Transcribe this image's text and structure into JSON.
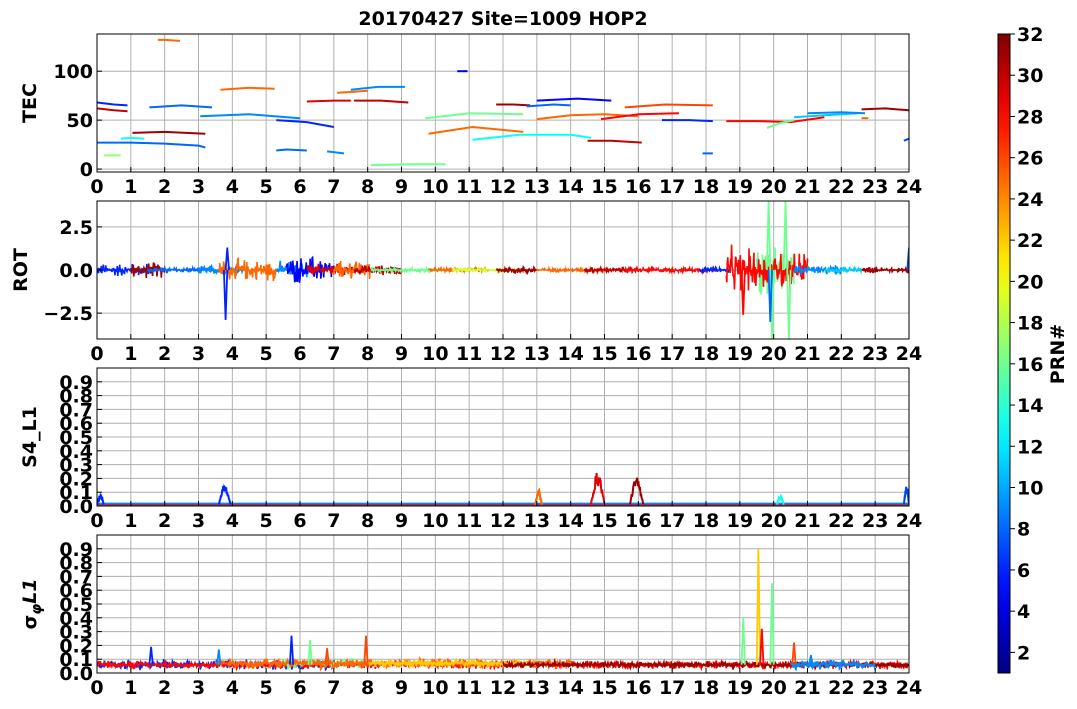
{
  "title": "20170427 Site=1009 HOP2",
  "colorbar": {
    "label": "PRN#",
    "min": 1,
    "max": 32,
    "ticks": [
      "2",
      "4",
      "6",
      "8",
      "10",
      "12",
      "14",
      "16",
      "18",
      "20",
      "22",
      "24",
      "26",
      "28",
      "30",
      "32"
    ]
  },
  "chart_data": [
    {
      "type": "line",
      "ylabel": "TEC",
      "xlim": [
        0,
        24
      ],
      "ylim": [
        -3,
        138
      ],
      "xticks": [
        "0",
        "1",
        "2",
        "3",
        "4",
        "5",
        "6",
        "7",
        "8",
        "9",
        "10",
        "11",
        "12",
        "13",
        "14",
        "15",
        "16",
        "17",
        "18",
        "19",
        "20",
        "21",
        "22",
        "23",
        "24"
      ],
      "yticks": [
        {
          "v": 0,
          "label": "0"
        },
        {
          "v": 50,
          "label": "50"
        },
        {
          "v": 100,
          "label": "100"
        }
      ],
      "grid": true,
      "series": [
        {
          "prn": 6,
          "x": [
            0,
            0.5,
            0.9
          ],
          "y": [
            68,
            66,
            65
          ]
        },
        {
          "prn": 30,
          "x": [
            0,
            0.5,
            0.9
          ],
          "y": [
            62,
            60,
            59
          ]
        },
        {
          "prn": 8,
          "x": [
            0,
            1,
            2,
            3,
            3.2
          ],
          "y": [
            27,
            27,
            26,
            24,
            22
          ]
        },
        {
          "prn": 13,
          "x": [
            0.7,
            1.0,
            1.4
          ],
          "y": [
            31,
            32,
            31
          ]
        },
        {
          "prn": 17,
          "x": [
            0.2,
            0.45,
            0.7
          ],
          "y": [
            14,
            14,
            14
          ]
        },
        {
          "prn": 31,
          "x": [
            1.05,
            2,
            3.2
          ],
          "y": [
            37,
            38,
            36
          ]
        },
        {
          "prn": 8,
          "x": [
            1.55,
            2.5,
            3.4
          ],
          "y": [
            63,
            65,
            63
          ]
        },
        {
          "prn": 25,
          "x": [
            1.8,
            2,
            2.45
          ],
          "y": [
            132,
            132,
            131
          ]
        },
        {
          "prn": 9,
          "x": [
            3.05,
            4.5,
            6.0
          ],
          "y": [
            54,
            56,
            52
          ]
        },
        {
          "prn": 25,
          "x": [
            3.65,
            4.5,
            5.25
          ],
          "y": [
            81,
            83,
            82
          ]
        },
        {
          "prn": 6,
          "x": [
            5.3,
            6.2,
            7.0
          ],
          "y": [
            50,
            48,
            43
          ]
        },
        {
          "prn": 8,
          "x": [
            5.3,
            5.6,
            6.2
          ],
          "y": [
            19,
            20,
            19
          ]
        },
        {
          "prn": 9,
          "x": [
            6.8,
            7.3
          ],
          "y": [
            18,
            16
          ]
        },
        {
          "prn": 29,
          "x": [
            6.2,
            7,
            7.5
          ],
          "y": [
            69,
            70,
            70
          ]
        },
        {
          "prn": 25,
          "x": [
            7.1,
            7.6,
            8.0
          ],
          "y": [
            78,
            79,
            80
          ]
        },
        {
          "prn": 9,
          "x": [
            7.5,
            8.3,
            9.1
          ],
          "y": [
            81,
            84,
            84
          ]
        },
        {
          "prn": 30,
          "x": [
            7.6,
            8.4,
            9.2
          ],
          "y": [
            70,
            70,
            68
          ]
        },
        {
          "prn": 16,
          "x": [
            8.1,
            9.2,
            10.3
          ],
          "y": [
            4,
            5,
            5
          ]
        },
        {
          "prn": 4,
          "x": [
            10.65,
            10.95
          ],
          "y": [
            100,
            100
          ]
        },
        {
          "prn": 16,
          "x": [
            9.7,
            11,
            12.6
          ],
          "y": [
            52,
            57,
            56
          ]
        },
        {
          "prn": 25,
          "x": [
            9.8,
            11.1,
            12.6
          ],
          "y": [
            36,
            43,
            38
          ]
        },
        {
          "prn": 13,
          "x": [
            11.1,
            12.5,
            14.0,
            14.6
          ],
          "y": [
            30,
            35,
            35,
            32
          ]
        },
        {
          "prn": 31,
          "x": [
            11.8,
            12.3,
            12.8
          ],
          "y": [
            66,
            66,
            65
          ]
        },
        {
          "prn": 8,
          "x": [
            12.7,
            13.5,
            14.0
          ],
          "y": [
            64,
            66,
            65
          ]
        },
        {
          "prn": 5,
          "x": [
            13.0,
            14.2,
            15.2
          ],
          "y": [
            70,
            72,
            70
          ]
        },
        {
          "prn": 25,
          "x": [
            13.0,
            14.0,
            15.0,
            16.0
          ],
          "y": [
            51,
            55,
            56,
            54
          ]
        },
        {
          "prn": 30,
          "x": [
            14.5,
            15.2,
            16.1
          ],
          "y": [
            29,
            29,
            27
          ]
        },
        {
          "prn": 28,
          "x": [
            14.9,
            16.0,
            17.2
          ],
          "y": [
            51,
            56,
            57
          ]
        },
        {
          "prn": 26,
          "x": [
            15.6,
            16.8,
            18.2
          ],
          "y": [
            63,
            66,
            65
          ]
        },
        {
          "prn": 6,
          "x": [
            16.7,
            17.5,
            18.2
          ],
          "y": [
            50,
            50,
            49
          ]
        },
        {
          "prn": 8,
          "x": [
            17.9,
            18.2
          ],
          "y": [
            16,
            16
          ]
        },
        {
          "prn": 28,
          "x": [
            18.6,
            19.5,
            20.5,
            21.5
          ],
          "y": [
            49,
            49,
            48,
            53
          ]
        },
        {
          "prn": 16,
          "x": [
            19.8,
            20.2,
            20.6
          ],
          "y": [
            42,
            47,
            50
          ]
        },
        {
          "prn": 11,
          "x": [
            20.6,
            21.5,
            22.5
          ],
          "y": [
            53,
            55,
            57
          ]
        },
        {
          "prn": 9,
          "x": [
            21.0,
            22.0,
            22.7
          ],
          "y": [
            57,
            58,
            57
          ]
        },
        {
          "prn": 25,
          "x": [
            22.6,
            22.8
          ],
          "y": [
            52,
            52
          ]
        },
        {
          "prn": 31,
          "x": [
            22.6,
            23.3,
            24
          ],
          "y": [
            61,
            62,
            60
          ]
        },
        {
          "prn": 7,
          "x": [
            23.85,
            24
          ],
          "y": [
            29,
            31
          ]
        }
      ]
    },
    {
      "type": "line",
      "ylabel": "ROT",
      "xlim": [
        0,
        24
      ],
      "ylim": [
        -4,
        4
      ],
      "xticks": [
        "0",
        "1",
        "2",
        "3",
        "4",
        "5",
        "6",
        "7",
        "8",
        "9",
        "10",
        "11",
        "12",
        "13",
        "14",
        "15",
        "16",
        "17",
        "18",
        "19",
        "20",
        "21",
        "22",
        "23",
        "24"
      ],
      "yticks": [
        {
          "v": -2.5,
          "label": "−2.5"
        },
        {
          "v": 0,
          "label": "0.0"
        },
        {
          "v": 2.5,
          "label": "2.5"
        }
      ],
      "grid": true,
      "noise_segments": [
        {
          "prn": 6,
          "x0": 0.0,
          "x1": 1.6,
          "amp": 0.35
        },
        {
          "prn": 31,
          "x0": 1.0,
          "x1": 2.0,
          "amp": 0.4
        },
        {
          "prn": 8,
          "x0": 1.5,
          "x1": 3.4,
          "amp": 0.15
        },
        {
          "prn": 9,
          "x0": 3.0,
          "x1": 4.3,
          "amp": 0.25
        },
        {
          "prn": 25,
          "x0": 3.6,
          "x1": 5.3,
          "amp": 0.55
        },
        {
          "prn": 9,
          "x0": 5.3,
          "x1": 6.3,
          "amp": 0.45
        },
        {
          "prn": 5,
          "x0": 5.6,
          "x1": 7.0,
          "amp": 0.7
        },
        {
          "prn": 29,
          "x0": 6.2,
          "x1": 7.6,
          "amp": 0.3
        },
        {
          "prn": 25,
          "x0": 7.0,
          "x1": 8.1,
          "amp": 0.45
        },
        {
          "prn": 30,
          "x0": 7.6,
          "x1": 9.0,
          "amp": 0.25
        },
        {
          "prn": 16,
          "x0": 8.1,
          "x1": 10.2,
          "amp": 0.1
        },
        {
          "prn": 25,
          "x0": 9.8,
          "x1": 11.6,
          "amp": 0.1
        },
        {
          "prn": 19,
          "x0": 10.5,
          "x1": 12.5,
          "amp": 0.08
        },
        {
          "prn": 31,
          "x0": 11.8,
          "x1": 13.0,
          "amp": 0.2
        },
        {
          "prn": 25,
          "x0": 13.0,
          "x1": 15.2,
          "amp": 0.1
        },
        {
          "prn": 30,
          "x0": 14.4,
          "x1": 16.0,
          "amp": 0.15
        },
        {
          "prn": 28,
          "x0": 15.6,
          "x1": 18.3,
          "amp": 0.12
        },
        {
          "prn": 6,
          "x0": 17.8,
          "x1": 18.7,
          "amp": 0.15
        },
        {
          "prn": 16,
          "x0": 19.5,
          "x1": 20.6,
          "amp": 1.4
        },
        {
          "prn": 28,
          "x0": 18.6,
          "x1": 21.0,
          "amp": 1.1
        },
        {
          "prn": 9,
          "x0": 20.6,
          "x1": 22.0,
          "amp": 0.25
        },
        {
          "prn": 11,
          "x0": 21.5,
          "x1": 22.6,
          "amp": 0.15
        },
        {
          "prn": 31,
          "x0": 22.6,
          "x1": 24.0,
          "amp": 0.15
        }
      ],
      "spikes": [
        {
          "prn": 6,
          "x": 3.8,
          "y": -2.9
        },
        {
          "prn": 6,
          "x": 3.85,
          "y": 1.3
        },
        {
          "prn": 28,
          "x": 19.1,
          "y": -2.6
        },
        {
          "prn": 16,
          "x": 19.85,
          "y": 4.0
        },
        {
          "prn": 16,
          "x": 19.95,
          "y": -4.0
        },
        {
          "prn": 16,
          "x": 20.35,
          "y": 4.0
        },
        {
          "prn": 16,
          "x": 20.45,
          "y": -4.0
        },
        {
          "prn": 8,
          "x": 19.9,
          "y": -3.0
        },
        {
          "prn": 7,
          "x": 24.0,
          "y": 1.3
        }
      ]
    },
    {
      "type": "line",
      "ylabel": "S4_L1",
      "xlim": [
        0,
        24
      ],
      "ylim": [
        0,
        1.0
      ],
      "xticks": [
        "0",
        "1",
        "2",
        "3",
        "4",
        "5",
        "6",
        "7",
        "8",
        "9",
        "10",
        "11",
        "12",
        "13",
        "14",
        "15",
        "16",
        "17",
        "18",
        "19",
        "20",
        "21",
        "22",
        "23",
        "24"
      ],
      "yticks": [
        {
          "v": 0,
          "label": "0.0"
        },
        {
          "v": 0.1,
          "label": "0.1"
        },
        {
          "v": 0.2,
          "label": "0.2"
        },
        {
          "v": 0.3,
          "label": "0.3"
        },
        {
          "v": 0.4,
          "label": "0.4"
        },
        {
          "v": 0.5,
          "label": "0.5"
        },
        {
          "v": 0.6,
          "label": "0.6"
        },
        {
          "v": 0.7,
          "label": "0.7"
        },
        {
          "v": 0.8,
          "label": "0.8"
        },
        {
          "v": 0.9,
          "label": "0.9"
        }
      ],
      "grid": true,
      "baseline": 0.01,
      "bursts": [
        {
          "prn": 6,
          "x0": 0.0,
          "x1": 0.2,
          "peak": 0.08
        },
        {
          "prn": 6,
          "x0": 3.6,
          "x1": 3.95,
          "peak": 0.15
        },
        {
          "prn": 25,
          "x0": 12.95,
          "x1": 13.15,
          "peak": 0.11
        },
        {
          "prn": 29,
          "x0": 14.6,
          "x1": 15.0,
          "peak": 0.24
        },
        {
          "prn": 31,
          "x0": 15.75,
          "x1": 16.15,
          "peak": 0.2
        },
        {
          "prn": 13,
          "x0": 20.1,
          "x1": 20.3,
          "peak": 0.07
        },
        {
          "prn": 7,
          "x0": 23.85,
          "x1": 24.0,
          "peak": 0.14
        }
      ]
    },
    {
      "type": "line",
      "ylabel": "σφL1",
      "xlim": [
        0,
        24
      ],
      "ylim": [
        0,
        1.0
      ],
      "xticks": [
        "0",
        "1",
        "2",
        "3",
        "4",
        "5",
        "6",
        "7",
        "8",
        "9",
        "10",
        "11",
        "12",
        "13",
        "14",
        "15",
        "16",
        "17",
        "18",
        "19",
        "20",
        "21",
        "22",
        "23",
        "24"
      ],
      "yticks": [
        {
          "v": 0,
          "label": "0.0"
        },
        {
          "v": 0.1,
          "label": "0.1"
        },
        {
          "v": 0.2,
          "label": "0.2"
        },
        {
          "v": 0.3,
          "label": "0.3"
        },
        {
          "v": 0.4,
          "label": "0.4"
        },
        {
          "v": 0.5,
          "label": "0.5"
        },
        {
          "v": 0.6,
          "label": "0.6"
        },
        {
          "v": 0.7,
          "label": "0.7"
        },
        {
          "v": 0.8,
          "label": "0.8"
        },
        {
          "v": 0.9,
          "label": "0.9"
        }
      ],
      "grid": true,
      "noise_segments": [
        {
          "prn": 6,
          "x0": 0.0,
          "x1": 7.0,
          "base": 0.06,
          "amp": 0.03
        },
        {
          "prn": 28,
          "x0": 0.0,
          "x1": 24.0,
          "base": 0.06,
          "amp": 0.025
        },
        {
          "prn": 16,
          "x0": 5.5,
          "x1": 8.0,
          "base": 0.07,
          "amp": 0.04
        },
        {
          "prn": 25,
          "x0": 3.5,
          "x1": 14.0,
          "base": 0.07,
          "amp": 0.03
        },
        {
          "prn": 22,
          "x0": 8.0,
          "x1": 13.0,
          "base": 0.07,
          "amp": 0.025
        },
        {
          "prn": 31,
          "x0": 12.0,
          "x1": 24.0,
          "base": 0.06,
          "amp": 0.02
        },
        {
          "prn": 9,
          "x0": 20.5,
          "x1": 23.0,
          "base": 0.06,
          "amp": 0.03
        }
      ],
      "spikes": [
        {
          "prn": 6,
          "x": 1.6,
          "y": 0.19
        },
        {
          "prn": 9,
          "x": 3.6,
          "y": 0.17
        },
        {
          "prn": 6,
          "x": 5.75,
          "y": 0.27
        },
        {
          "prn": 16,
          "x": 6.3,
          "y": 0.24
        },
        {
          "prn": 26,
          "x": 6.8,
          "y": 0.18
        },
        {
          "prn": 26,
          "x": 7.95,
          "y": 0.27
        },
        {
          "prn": 16,
          "x": 19.1,
          "y": 0.4
        },
        {
          "prn": 22,
          "x": 19.55,
          "y": 0.9
        },
        {
          "prn": 16,
          "x": 19.95,
          "y": 0.65
        },
        {
          "prn": 28,
          "x": 19.65,
          "y": 0.32
        },
        {
          "prn": 26,
          "x": 20.6,
          "y": 0.22
        },
        {
          "prn": 9,
          "x": 21.1,
          "y": 0.13
        }
      ]
    }
  ]
}
